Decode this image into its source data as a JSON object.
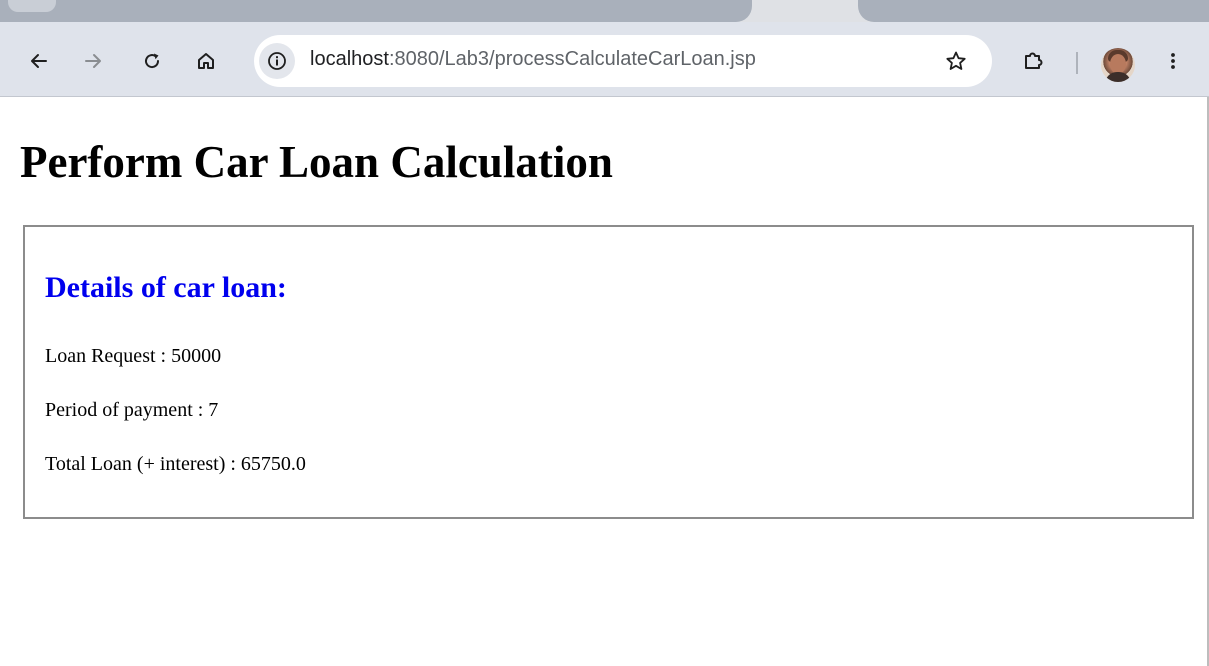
{
  "browser": {
    "url_host": "localhost",
    "url_path": ":8080/Lab3/processCalculateCarLoan.jsp",
    "icons": {
      "back": "back-arrow-icon",
      "forward": "forward-arrow-icon",
      "reload": "reload-icon",
      "home": "home-icon",
      "site_info": "info-icon",
      "bookmark": "star-icon",
      "extensions": "puzzle-icon",
      "menu": "three-dots-icon"
    }
  },
  "page": {
    "title": "Perform Car Loan Calculation",
    "details": {
      "heading": "Details of car loan:",
      "loan_request": "Loan Request : 50000",
      "period": "Period of payment : 7",
      "total": "Total Loan (+ interest) : 65750.0"
    }
  },
  "colors": {
    "heading_blue": "#0000ee",
    "toolbar_bg": "#dfe3eb",
    "tabstrip_bg": "#a9b0bb"
  }
}
